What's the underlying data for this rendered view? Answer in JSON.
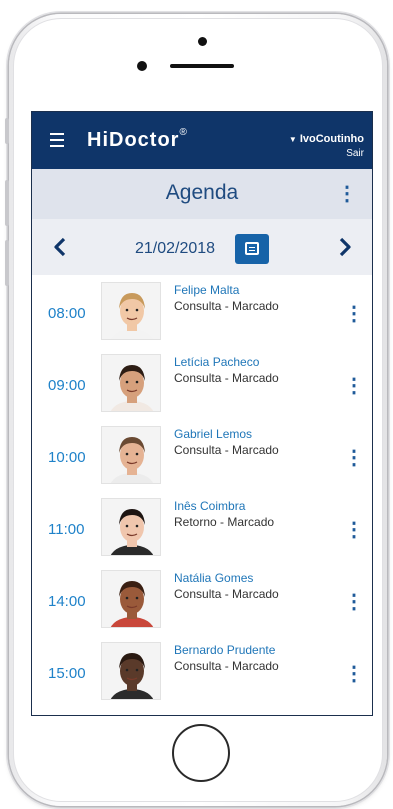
{
  "header": {
    "logo": "HiDoctor",
    "logo_mark": "®",
    "user_name": "IvoCoutinho",
    "logout_label": "Sair"
  },
  "page": {
    "title": "Agenda"
  },
  "date_nav": {
    "date": "21/02/2018"
  },
  "appointments": [
    {
      "time": "08:00",
      "name": "Felipe Malta",
      "status": "Consulta - Marcado",
      "skin": "#f1c8a6",
      "hair": "#c89a5c",
      "shirt": "#f3f3f3"
    },
    {
      "time": "09:00",
      "name": "Letícia Pacheco",
      "status": "Consulta - Marcado",
      "skin": "#d6a07c",
      "hair": "#2d1d14",
      "shirt": "#f1e9e3"
    },
    {
      "time": "10:00",
      "name": "Gabriel Lemos",
      "status": "Consulta - Marcado",
      "skin": "#e5b394",
      "hair": "#6a4a33",
      "shirt": "#ececec"
    },
    {
      "time": "11:00",
      "name": "Inês Coimbra",
      "status": "Retorno - Marcado",
      "skin": "#f0c6ad",
      "hair": "#1e1512",
      "shirt": "#2a2a2a"
    },
    {
      "time": "14:00",
      "name": "Natália Gomes",
      "status": "Consulta - Marcado",
      "skin": "#9a5a3a",
      "hair": "#3a1f12",
      "shirt": "#c9473a"
    },
    {
      "time": "15:00",
      "name": "Bernardo Prudente",
      "status": "Consulta - Marcado",
      "skin": "#5a3a2a",
      "hair": "#2a1a12",
      "shirt": "#2b2b2b"
    }
  ]
}
